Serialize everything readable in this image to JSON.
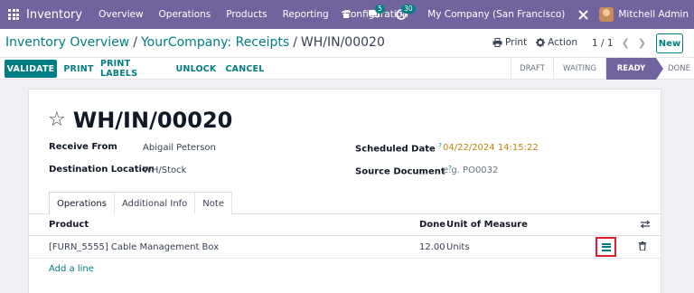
{
  "navbar": {
    "app_name": "Inventory",
    "menus": [
      "Overview",
      "Operations",
      "Products",
      "Reporting",
      "Configuration"
    ],
    "chat_count": "5",
    "activity_count": "30",
    "company": "My Company (San Francisco)",
    "user": "Mitchell Admin",
    "accent": "#71639e"
  },
  "breadcrumb": {
    "items": [
      "Inventory Overview",
      "YourCompany: Receipts"
    ],
    "current": "WH/IN/00020"
  },
  "actions": {
    "print": "Print",
    "action": "Action"
  },
  "pager": {
    "value": "1 / 1"
  },
  "new_label": "New",
  "statusbar": {
    "buttons": [
      "VALIDATE",
      "PRINT",
      "PRINT LABELS",
      "UNLOCK",
      "CANCEL"
    ],
    "stages": [
      "DRAFT",
      "WAITING",
      "READY",
      "DONE"
    ],
    "active_stage": "READY"
  },
  "record": {
    "title": "WH/IN/00020",
    "receive_from_label": "Receive From",
    "receive_from": "Abigail Peterson",
    "destination_label": "Destination Location",
    "destination": "WH/Stock",
    "scheduled_label": "Scheduled Date",
    "scheduled": "04/22/2024 14:15:22",
    "source_label": "Source Document",
    "source_placeholder": "e.g. PO0032",
    "help_mark": "?"
  },
  "tabs": [
    "Operations",
    "Additional Info",
    "Note"
  ],
  "table": {
    "headers": {
      "product": "Product",
      "done": "Done",
      "uom": "Unit of Measure"
    },
    "rows": [
      {
        "product": "[FURN_5555] Cable Management Box",
        "done": "12.00",
        "uom": "Units"
      }
    ],
    "add_line": "Add a line"
  }
}
